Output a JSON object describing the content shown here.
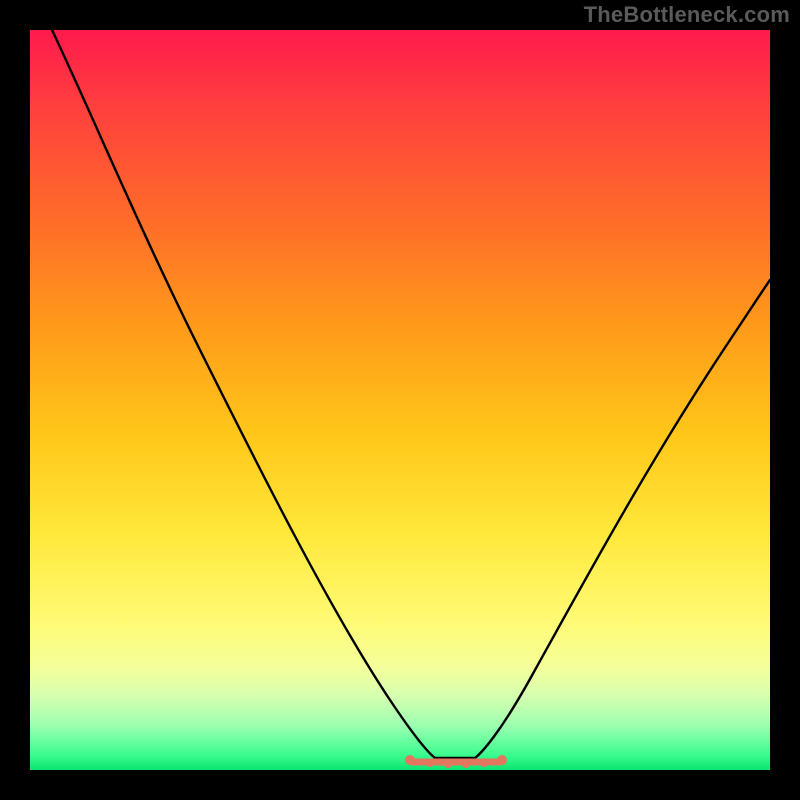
{
  "watermark": "TheBottleneck.com",
  "chart_data": {
    "type": "line",
    "title": "",
    "xlabel": "",
    "ylabel": "",
    "xlim": [
      0,
      100
    ],
    "ylim": [
      0,
      100
    ],
    "grid": false,
    "legend": false,
    "series": [
      {
        "name": "bottleneck-curve",
        "color": "#000000",
        "points": [
          {
            "x": 3,
            "y": 100
          },
          {
            "x": 10,
            "y": 85
          },
          {
            "x": 20,
            "y": 65
          },
          {
            "x": 30,
            "y": 45
          },
          {
            "x": 40,
            "y": 25
          },
          {
            "x": 48,
            "y": 8
          },
          {
            "x": 52,
            "y": 2
          },
          {
            "x": 55,
            "y": 0.8
          },
          {
            "x": 60,
            "y": 0.8
          },
          {
            "x": 63,
            "y": 2
          },
          {
            "x": 68,
            "y": 8
          },
          {
            "x": 75,
            "y": 20
          },
          {
            "x": 85,
            "y": 38
          },
          {
            "x": 95,
            "y": 55
          },
          {
            "x": 100,
            "y": 63
          }
        ]
      }
    ],
    "highlight_band": {
      "name": "optimal-range",
      "color": "#e2765f",
      "x_start": 51,
      "x_end": 64,
      "y": 1
    },
    "background_gradient": {
      "top": "#ff1a4d",
      "bottom": "#0be46e"
    }
  }
}
